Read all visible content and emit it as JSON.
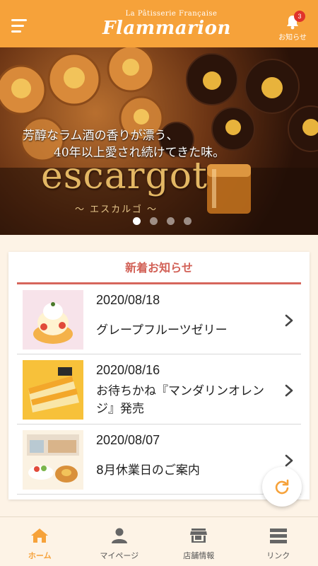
{
  "header": {
    "logo_subtitle": "La Pâtisserie Française",
    "logo_title": "Flammarion",
    "notification_label": "お知らせ",
    "notification_count": "3"
  },
  "banner": {
    "tagline_line1": "芳醇なラム酒の香りが漂う、",
    "tagline_line2": "40年以上愛され続けてきた味。",
    "title": "escargot",
    "subtitle": "～ エスカルゴ ～",
    "slide_count": 4,
    "active_slide": 1
  },
  "news": {
    "heading": "新着お知らせ",
    "items": [
      {
        "date": "2020/08/18",
        "title": "グレープフルーツゼリー"
      },
      {
        "date": "2020/08/16",
        "title": "お待ちかね『マンダリンオレンジ』発売"
      },
      {
        "date": "2020/08/07",
        "title": "8月休業日のご案内"
      }
    ]
  },
  "tabs": [
    {
      "label": "ホーム",
      "icon": "home-icon",
      "active": true
    },
    {
      "label": "マイページ",
      "icon": "person-icon",
      "active": false
    },
    {
      "label": "店舗情報",
      "icon": "store-icon",
      "active": false
    },
    {
      "label": "リンク",
      "icon": "list-icon",
      "active": false
    }
  ],
  "colors": {
    "brand": "#f6a23a",
    "news_accent": "#d26157",
    "badge": "#e0322a",
    "background": "#fdf3e6"
  }
}
